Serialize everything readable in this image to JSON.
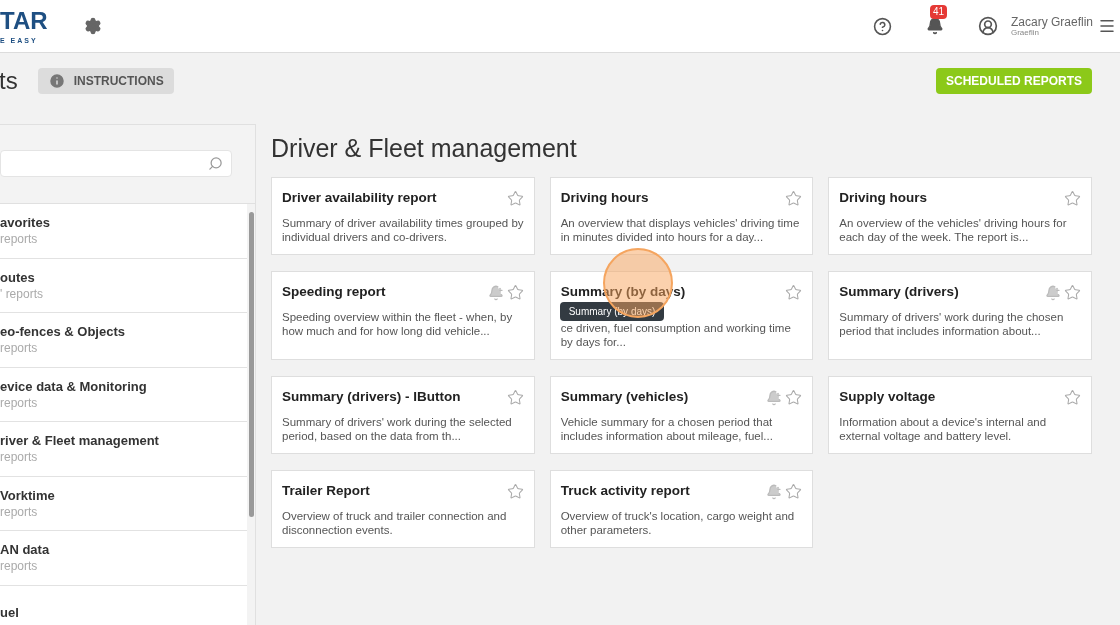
{
  "header": {
    "logo_text": "TAR",
    "logo_tagline": "E EASY",
    "notification_count": "41",
    "user_name": "Zacary Graeflin",
    "user_company": "Graeflin"
  },
  "page": {
    "title": "ts",
    "instructions_button": "INSTRUCTIONS",
    "scheduled_button": "SCHEDULED REPORTS"
  },
  "sidebar": {
    "items": [
      {
        "name": "avorites",
        "count": "reports",
        "selected": false
      },
      {
        "name": "outes",
        "count": "' reports",
        "selected": false
      },
      {
        "name": "eo-fences & Objects",
        "count": "reports",
        "selected": false
      },
      {
        "name": "evice data & Monitoring",
        "count": "reports",
        "selected": false
      },
      {
        "name": "river & Fleet management",
        "count": "reports",
        "selected": false
      },
      {
        "name": "Vorktime",
        "count": "reports",
        "selected": false
      },
      {
        "name": "AN data",
        "count": "reports",
        "selected": false
      },
      {
        "name": "uel",
        "selected": false
      }
    ]
  },
  "section": {
    "title": "Driver & Fleet management",
    "cards": [
      {
        "title": "Driver availability report",
        "description": "Summary of driver availability times grouped by individual drivers and co-drivers.",
        "alert": false
      },
      {
        "title": "Driving hours",
        "description": "An overview that displays vehicles' driving time in minutes divided into hours for a day...",
        "alert": false
      },
      {
        "title": "Driving hours",
        "description": "An overview of the vehicles' driving hours for each day of the week. The report is...",
        "alert": false
      },
      {
        "title": "Speeding report",
        "description": "Speeding overview within the fleet - when, by how much and for how long did vehicle...",
        "alert": true
      },
      {
        "title": "Summary (by days)",
        "description": "ce driven, fuel consumption and working time by days for...",
        "alert": false,
        "tooltip": "Summary (by days)"
      },
      {
        "title": "Summary (drivers)",
        "description": "Summary of drivers' work during the chosen period that includes information about...",
        "alert": true
      },
      {
        "title": "Summary (drivers) - IButton",
        "description": "Summary of drivers' work during the selected period, based on the data from th...",
        "alert": false
      },
      {
        "title": "Summary (vehicles)",
        "description": "Vehicle summary for a chosen period that includes information about mileage, fuel...",
        "alert": true
      },
      {
        "title": "Supply voltage",
        "description": "Information about a device's internal and external voltage and battery level.",
        "alert": false
      },
      {
        "title": "Trailer Report",
        "description": "Overview of truck and trailer connection and disconnection events.",
        "alert": false
      },
      {
        "title": "Truck activity report",
        "description": "Overview of truck's location, cargo weight and other parameters.",
        "alert": true
      }
    ]
  }
}
